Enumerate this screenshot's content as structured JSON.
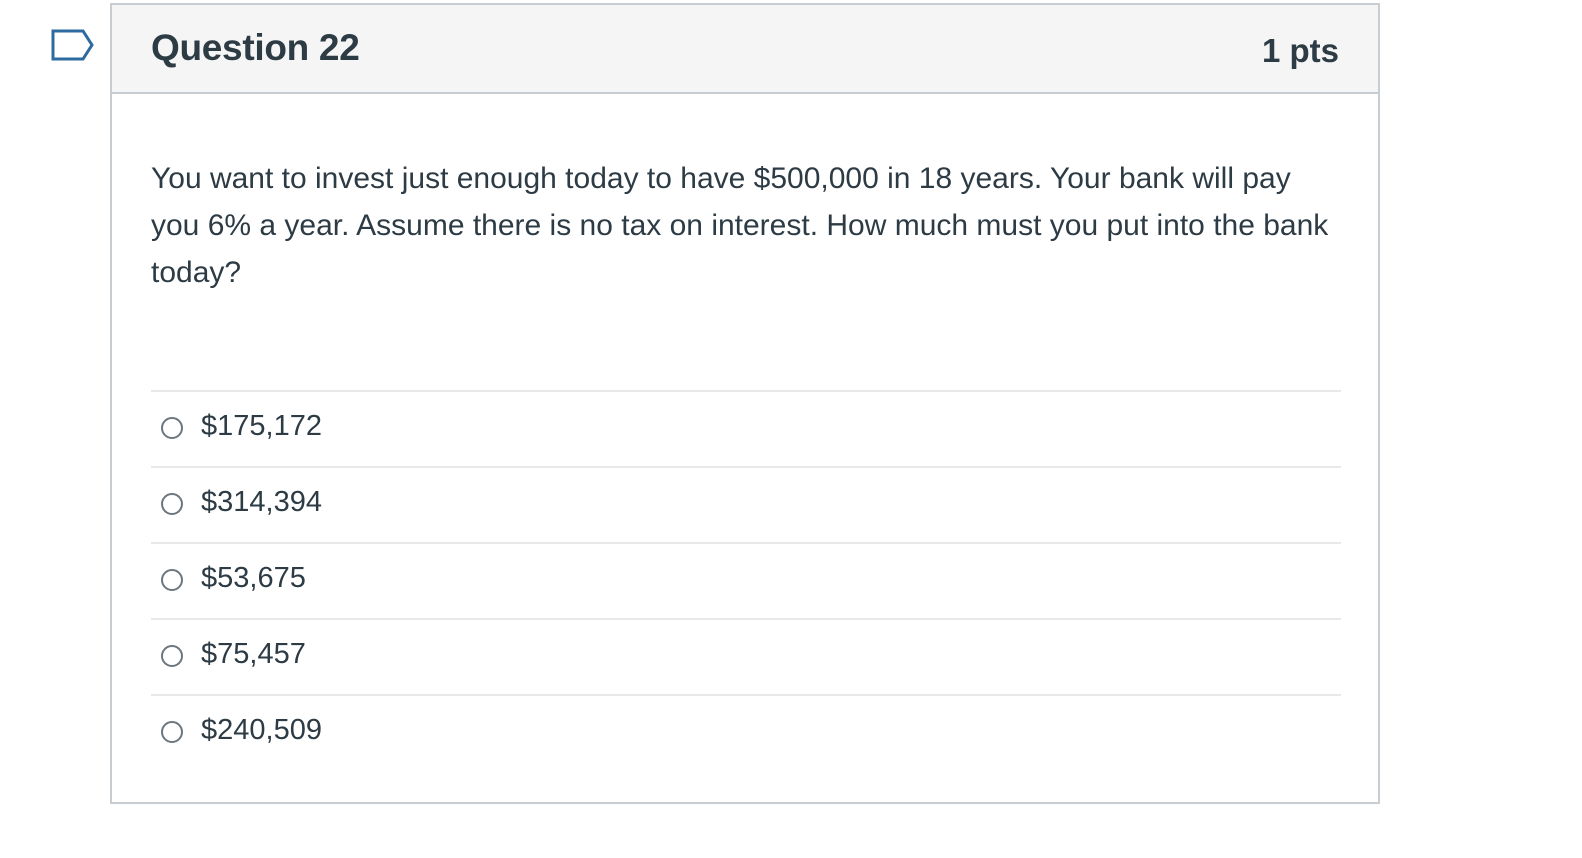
{
  "flag": {
    "icon": "flag-question-icon",
    "color": "#2d6a9f"
  },
  "question": {
    "title": "Question 22",
    "points": "1 pts",
    "text": "You want to invest just enough today to have $500,000 in 18 years. Your bank will pay you 6% a year. Assume there is no tax on interest. How much must you put into the bank today?",
    "answers": [
      {
        "label": "$175,172",
        "selected": false
      },
      {
        "label": "$314,394",
        "selected": false
      },
      {
        "label": "$53,675",
        "selected": false
      },
      {
        "label": "$75,457",
        "selected": false
      },
      {
        "label": "$240,509",
        "selected": false
      }
    ]
  },
  "colors": {
    "text": "#2d3b45",
    "header_bg": "#f5f5f5",
    "border": "#c7cdd1",
    "divider": "#e6e8ea"
  }
}
